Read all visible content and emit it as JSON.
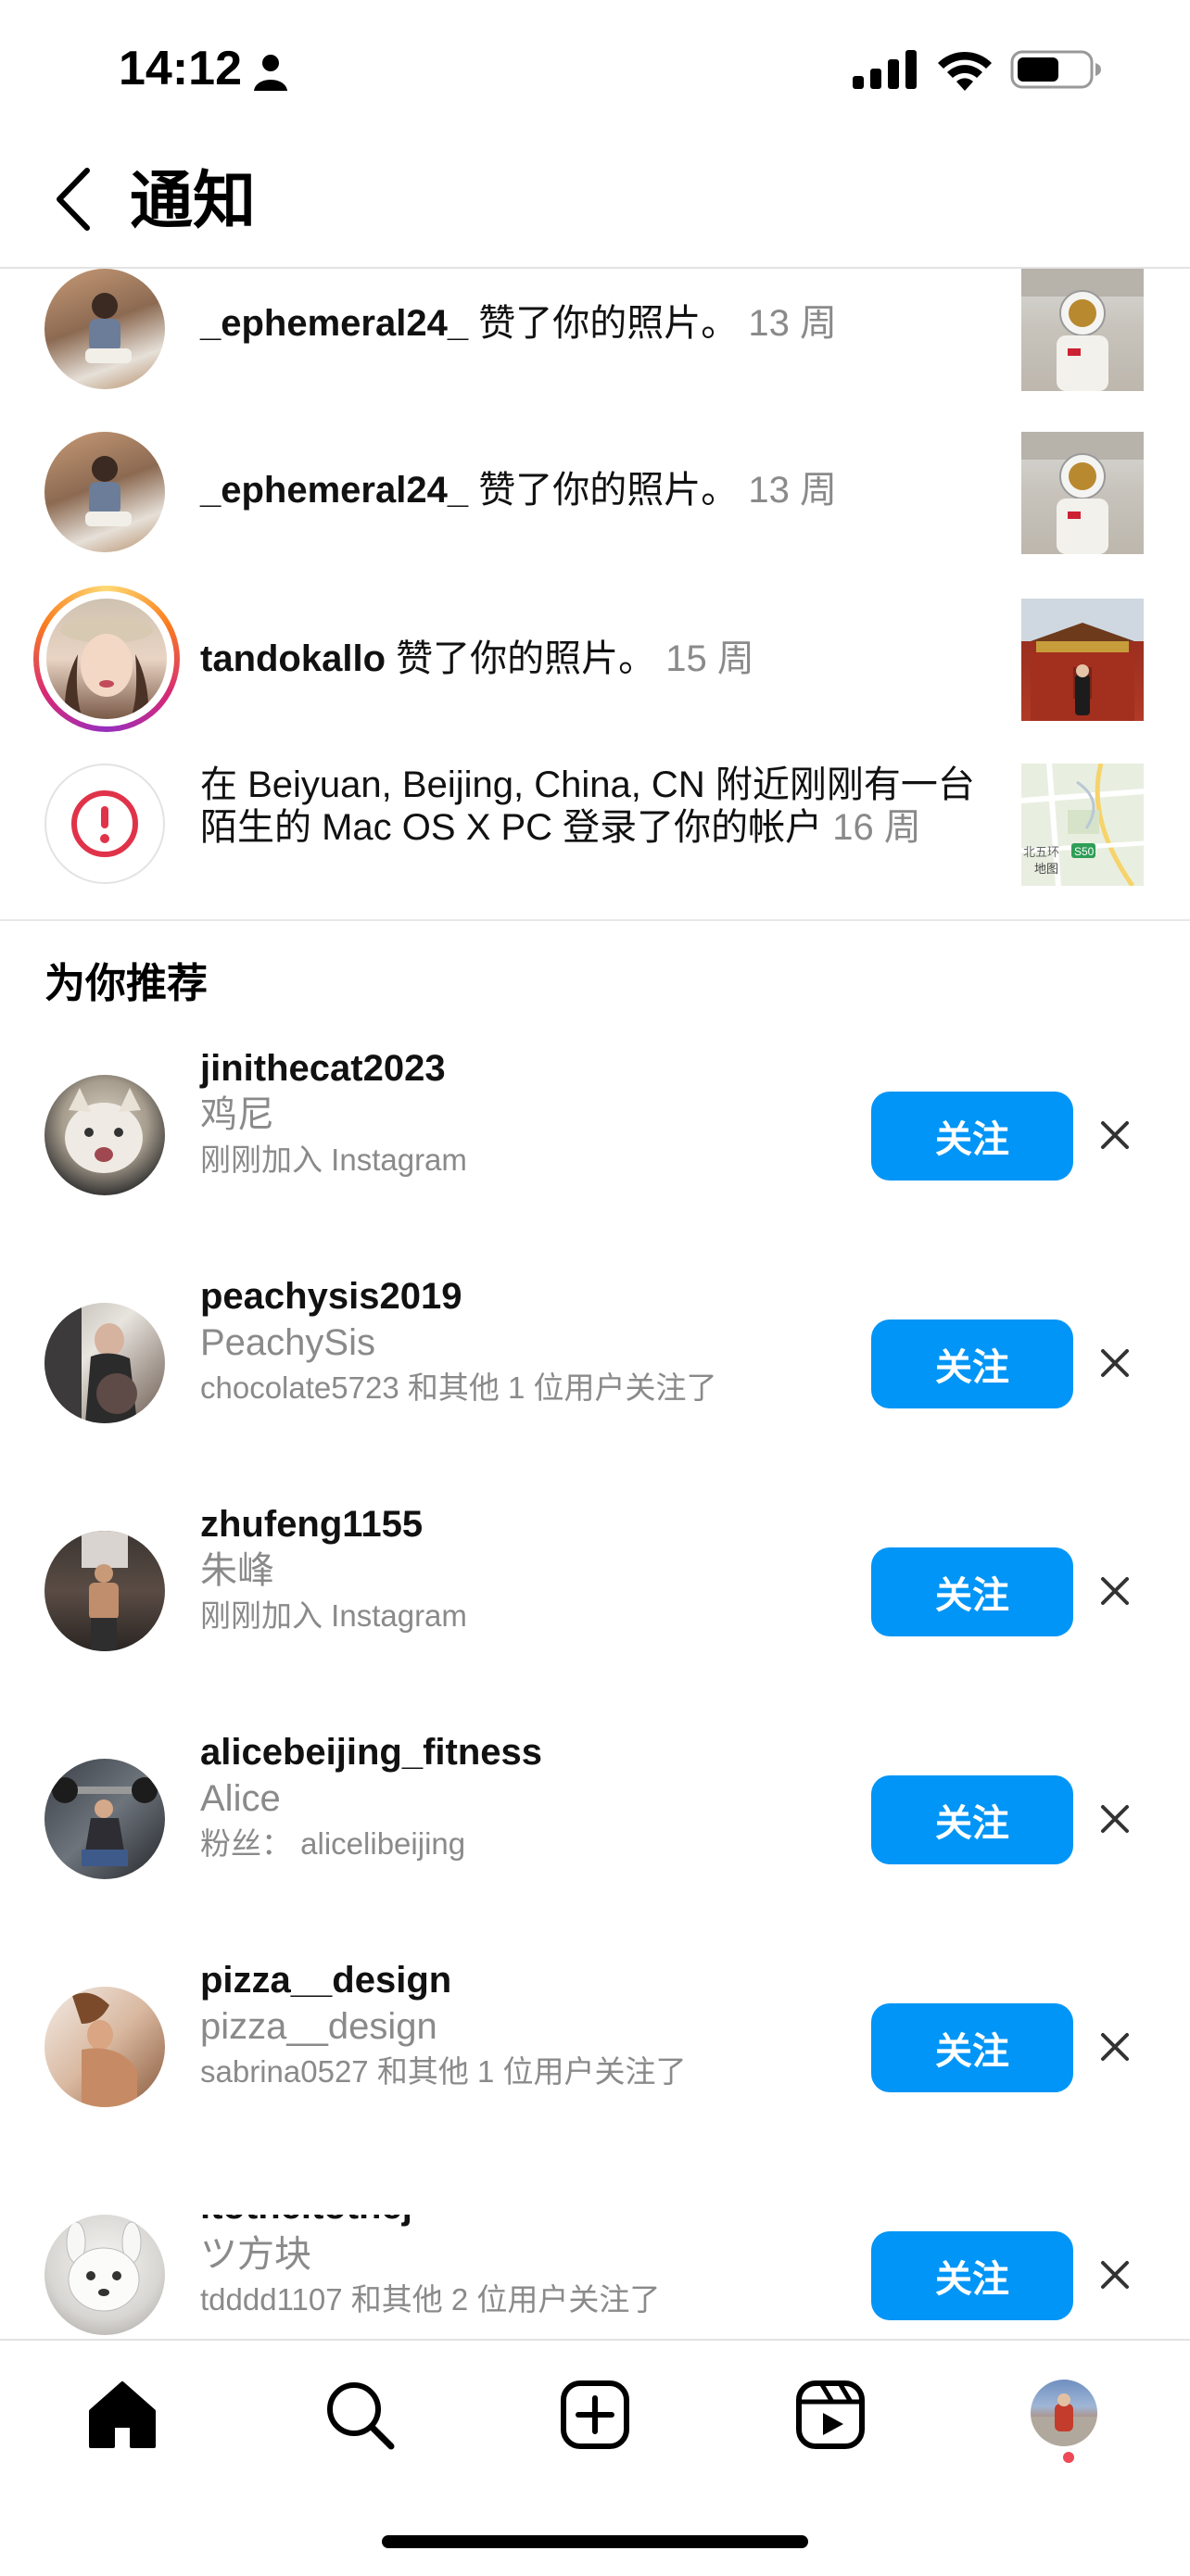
{
  "status_bar": {
    "time": "14:12"
  },
  "header": {
    "title": "通知"
  },
  "notifications": [
    {
      "username": "_ephemeral24_",
      "action": " 赞了你的照片。",
      "time": "13 周"
    },
    {
      "username": "_ephemeral24_",
      "action": " 赞了你的照片。",
      "time": "13 周"
    },
    {
      "username": "tandokallo",
      "action": " 赞了你的照片。",
      "time": "15 周"
    },
    {
      "username": "",
      "action": "在 Beiyuan, Beijing, China, CN 附近刚刚有一台陌生的 Mac OS X PC 登录了你的帐户",
      "time": "16 周"
    }
  ],
  "map_thumb": {
    "label": "北五环",
    "badge": "S50",
    "brand": "地图"
  },
  "suggestions": {
    "title": "为你推荐",
    "follow_label": "关注",
    "items": [
      {
        "username": "jinithecat2023",
        "fullname": "鸡尼",
        "context": "刚刚加入 Instagram"
      },
      {
        "username": "peachysis2019",
        "fullname": "PeachySis",
        "context": "chocolate5723 和其他 1 位用户关注了"
      },
      {
        "username": "zhufeng1155",
        "fullname": "朱峰",
        "context": "刚刚加入 Instagram"
      },
      {
        "username": "alicebeijing_fitness",
        "fullname": "Alice",
        "context": "粉丝： alicelibeijing"
      },
      {
        "username": "pizza__design",
        "fullname": "pizza__design",
        "context": "sabrina0527 和其他 1 位用户关注了"
      },
      {
        "username": "ltotheltothej",
        "fullname": "ツ方块",
        "context": "tdddd1107 和其他 2 位用户关注了"
      }
    ]
  },
  "tabbar": {
    "tabs": [
      "home-icon",
      "search-icon",
      "create-icon",
      "reels-icon",
      "profile-avatar"
    ]
  },
  "colors": {
    "accent": "#0095f6",
    "alert": "#e0334a",
    "dot": "#ed4956"
  }
}
